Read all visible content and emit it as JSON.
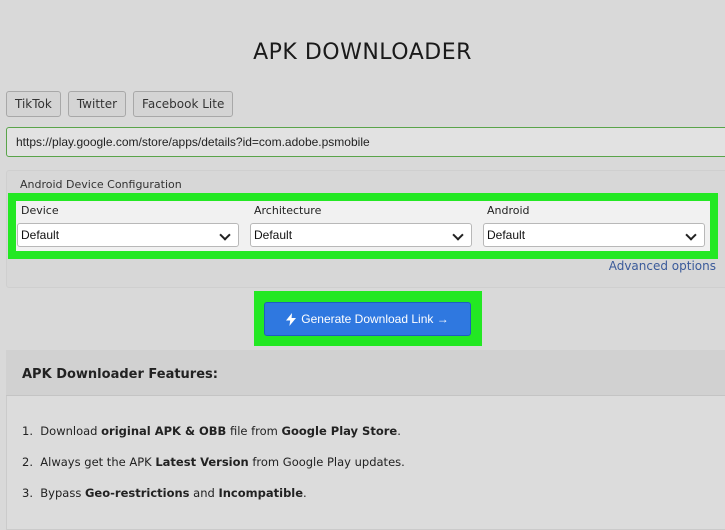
{
  "page": {
    "title": "APK DOWNLOADER"
  },
  "quick_links": [
    "TikTok",
    "Twitter",
    "Facebook Lite"
  ],
  "url_input": {
    "value": "https://play.google.com/store/apps/details?id=com.adobe.psmobile"
  },
  "config": {
    "label": "Android Device Configuration",
    "selects": [
      {
        "label": "Device",
        "value": "Default"
      },
      {
        "label": "Architecture",
        "value": "Default"
      },
      {
        "label": "Android",
        "value": "Default"
      }
    ],
    "advanced_link": "Advanced options"
  },
  "generate_button": {
    "label": "Generate Download Link →",
    "icon": "lightning-bolt-icon"
  },
  "features": {
    "title": "APK Downloader Features:",
    "items": [
      {
        "num": "1.",
        "parts": [
          "Download ",
          "original APK & OBB",
          " file from ",
          "Google Play Store",
          "."
        ]
      },
      {
        "num": "2.",
        "parts": [
          "Always get the APK ",
          "Latest Version",
          " from Google Play updates.",
          "",
          ""
        ]
      },
      {
        "num": "3.",
        "parts": [
          "Bypass ",
          "Geo-restrictions",
          " and ",
          "Incompatible",
          "."
        ]
      }
    ]
  },
  "colors": {
    "highlight": "#23e823",
    "button": "#2f78e0",
    "link": "#3a5a9a"
  }
}
